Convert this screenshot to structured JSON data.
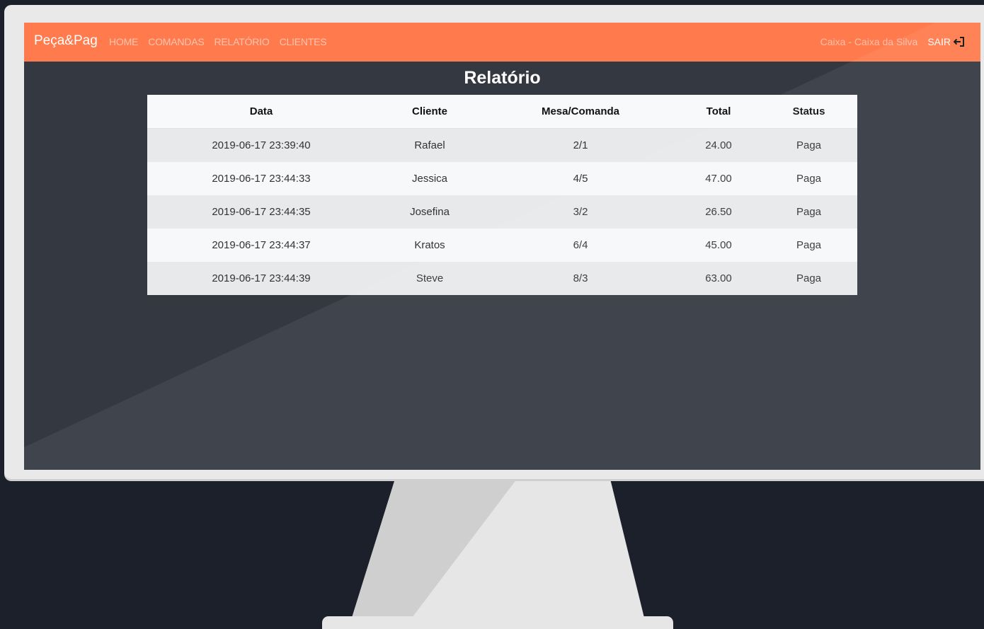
{
  "navbar": {
    "brand": "Peça&Pag",
    "links": [
      {
        "label": "HOME"
      },
      {
        "label": "COMANDAS"
      },
      {
        "label": "RELATÓRIO"
      },
      {
        "label": "CLIENTES"
      }
    ],
    "user": "Caixa - Caixa da Silva",
    "logout_label": "SAIR",
    "logout_icon": "sign-out-icon"
  },
  "page": {
    "title": "Relatório"
  },
  "table": {
    "headers": {
      "data": "Data",
      "cliente": "Cliente",
      "mesa": "Mesa/Comanda",
      "total": "Total",
      "status": "Status"
    },
    "rows": [
      {
        "data": "2019-06-17 23:39:40",
        "cliente": "Rafael",
        "mesa": "2/1",
        "total": "24.00",
        "status": "Paga"
      },
      {
        "data": "2019-06-17 23:44:33",
        "cliente": "Jessica",
        "mesa": "4/5",
        "total": "47.00",
        "status": "Paga"
      },
      {
        "data": "2019-06-17 23:44:35",
        "cliente": "Josefina",
        "mesa": "3/2",
        "total": "26.50",
        "status": "Paga"
      },
      {
        "data": "2019-06-17 23:44:37",
        "cliente": "Kratos",
        "mesa": "6/4",
        "total": "45.00",
        "status": "Paga"
      },
      {
        "data": "2019-06-17 23:44:39",
        "cliente": "Steve",
        "mesa": "8/3",
        "total": "63.00",
        "status": "Paga"
      }
    ]
  },
  "colors": {
    "navbar": "#ff7b4d",
    "screen_background": "#343841",
    "page_background": "#1b202b",
    "monitor": "#e9e9e9"
  }
}
